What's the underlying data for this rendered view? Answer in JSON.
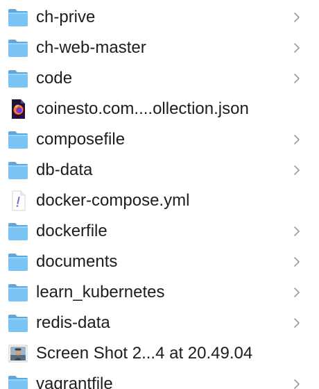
{
  "files": [
    {
      "name": "ch-prive",
      "kind": "folder",
      "icon": "folder-icon"
    },
    {
      "name": "ch-web-master",
      "kind": "folder",
      "icon": "folder-icon"
    },
    {
      "name": "code",
      "kind": "folder",
      "icon": "folder-icon"
    },
    {
      "name": "coinesto.com....ollection.json",
      "kind": "file",
      "icon": "firefox-document-icon"
    },
    {
      "name": "composefile",
      "kind": "folder",
      "icon": "folder-icon"
    },
    {
      "name": "db-data",
      "kind": "folder",
      "icon": "folder-icon"
    },
    {
      "name": "docker-compose.yml",
      "kind": "file",
      "icon": "yaml-document-icon"
    },
    {
      "name": "dockerfile",
      "kind": "folder",
      "icon": "folder-icon"
    },
    {
      "name": "documents",
      "kind": "folder",
      "icon": "folder-icon"
    },
    {
      "name": "learn_kubernetes",
      "kind": "folder",
      "icon": "folder-icon"
    },
    {
      "name": "redis-data",
      "kind": "folder",
      "icon": "folder-icon"
    },
    {
      "name": "Screen Shot 2...4 at 20.49.04",
      "kind": "file",
      "icon": "image-thumbnail-icon"
    },
    {
      "name": "vagrantfile",
      "kind": "folder",
      "icon": "folder-icon"
    }
  ],
  "colors": {
    "folder_back": "#5aa8e6",
    "folder_front": "#7cc3f5",
    "text": "#1d1d1f",
    "chevron": "#9a9a9a"
  }
}
